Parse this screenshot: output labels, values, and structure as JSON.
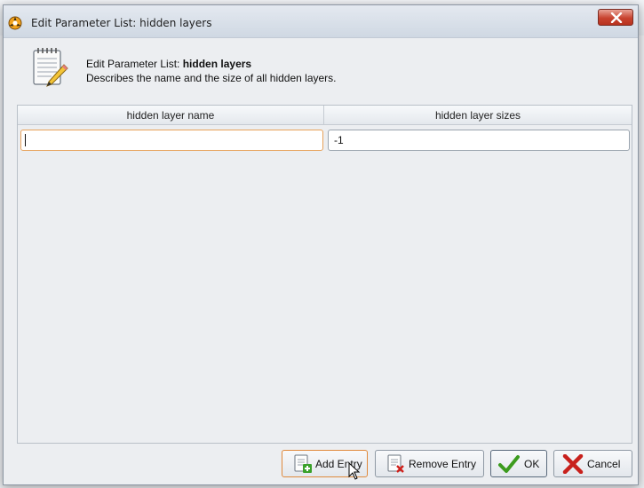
{
  "window": {
    "title": "Edit Parameter List: hidden layers",
    "close_icon": "close-icon"
  },
  "header": {
    "title_prefix": "Edit Parameter List: ",
    "title_param": "hidden layers",
    "description": "Describes the name and the size of all hidden layers.",
    "icon": "notepad-pencil-icon"
  },
  "table": {
    "columns": [
      "hidden layer name",
      "hidden layer sizes"
    ],
    "rows": [
      {
        "name": "",
        "size": "-1"
      }
    ]
  },
  "buttons": {
    "add": "Add Entry",
    "remove": "Remove Entry",
    "ok": "OK",
    "cancel": "Cancel"
  },
  "colors": {
    "focus_orange": "#e8a25a",
    "ok_green": "#3c9b1e",
    "cancel_red": "#c8201c",
    "close_red": "#c8432f"
  }
}
